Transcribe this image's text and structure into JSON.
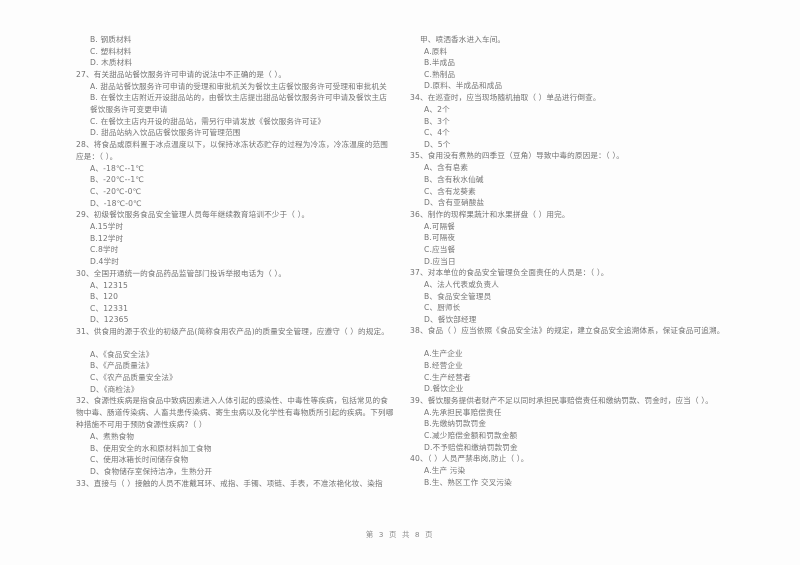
{
  "document": {
    "type": "exam-paper",
    "footer": {
      "prefix": "第",
      "page_number": "3",
      "middle": "页  共",
      "total_pages": "8",
      "suffix": "页",
      "full_text": "第 3 页  共 8 页"
    }
  },
  "left_column": {
    "continued_options": [
      "B. 钢质材料",
      "C. 塑料材料",
      "D. 木质材料"
    ],
    "questions": [
      {
        "number": "27",
        "text": "27、有关甜品站餐饮服务许可申请的说法中不正确的是（      ）。",
        "options": [
          "A. 甜品站餐饮服务许可申请的受理和审批机关为餐饮主店餐饮服务许可受理和审批机关",
          "B. 在餐饮主店附近开设甜品站的，由餐饮主店提出甜品站餐饮服务许可申请及餐饮主店餐饮服务许可变更申请",
          "C. 在餐饮主店内开设的甜品站，需另行申请发放《餐饮服务许可证》",
          "D. 甜品站纳入饮品店餐饮服务许可管理范围"
        ]
      },
      {
        "number": "28",
        "text": "28、将食品或原料置于冰点温度以下，以保持冰冻状态贮存的过程为冷冻，冷冻温度的范围应是：（      ）。",
        "options": [
          "A、-18℃--1℃",
          "B、-20℃--1℃",
          "C、-20℃-0℃",
          "D、-18℃-0℃"
        ]
      },
      {
        "number": "29",
        "text": "29、初级餐饮服务食品安全管理人员每年继续教育培训不少于（      ）。",
        "options": [
          "A.15学时",
          "B.12学时",
          "C.8学时",
          "D.4学时"
        ]
      },
      {
        "number": "30",
        "text": "30、全国开通统一的食品药品监管部门投诉举报电话为（      ）。",
        "options": [
          "A、12315",
          "B、120",
          "C、12331",
          "D、12365"
        ]
      },
      {
        "number": "31",
        "text": "31、供食用的源于农业的初级产品(简称食用农产品)的质量安全管理，应遵守（      ）的规定。",
        "options": [
          "A、《食品安全法》",
          "B、《产品质量法》",
          "C、《农产品质量安全法》",
          "D、《商检法》"
        ]
      },
      {
        "number": "32",
        "text": "32、食源性疾病是指食品中致病因素进入人体引起的感染性、中毒性等疾病，包括常见的食物中毒、肠道传染病、人畜共患传染病、寄生虫病以及化学性有毒物质所引起的疾病。下列哪种措施不可用于预防食源性疾病?（      ）",
        "options": [
          "A、煮熟食物",
          "B、使用安全的水和原材料加工食物",
          "C、使用冰箱长时间储存食物",
          "D、食物储存室保持洁净，生熟分开"
        ]
      },
      {
        "number": "33",
        "text": "33、直接与（      ）接触的人员不准戴耳环、戒指、手镯、项链、手表，不准浓艳化妆、染指",
        "options": []
      }
    ]
  },
  "right_column": {
    "continued_lead": "甲、喷洒香水进入车间。",
    "continued_options": [
      "A.原料",
      "B.半成品",
      "C.熟制品",
      "D.原料、半成品和成品"
    ],
    "questions": [
      {
        "number": "34",
        "text": "34、在巡查时，应当现场随机抽取（      ）单品进行倒查。",
        "options": [
          "A、2个",
          "B、3个",
          "C、4个",
          "D、5个"
        ]
      },
      {
        "number": "35",
        "text": "35、食用没有煮熟的四季豆（豆角）导致中毒的原因是：（      ）。",
        "options": [
          "A、含有皂素",
          "B、含有秋水仙碱",
          "C、含有龙葵素",
          "D、含有亚硝酸盐"
        ]
      },
      {
        "number": "36",
        "text": "36、制作的现榨果蔬汁和水果拼盘（      ）用完。",
        "options": [
          "A.可隔餐",
          "B.可隔夜",
          "C.应当餐",
          "D.应当日"
        ]
      },
      {
        "number": "37",
        "text": "37、对本单位的食品安全管理负全面责任的人员是：（      ）。",
        "options": [
          "A、法人代表或负责人",
          "B、食品安全管理员",
          "C、厨师长",
          "D、餐饮部经理"
        ]
      },
      {
        "number": "38",
        "text": "38、食品（      ）应当依照《食品安全法》的规定，建立食品安全追溯体系，保证食品可追溯。",
        "options": [
          "A.生产企业",
          "B.经营企业",
          "C.生产经营者",
          "D.餐饮企业"
        ]
      },
      {
        "number": "39",
        "text": "39、餐饮服务提供者财产不足以同时承担民事赔偿责任和缴纳罚款、罚金时，应当（      ）。",
        "options": [
          "A.先承担民事赔偿责任",
          "B.先缴纳罚款罚金",
          "C.减少赔偿金额和罚款金额",
          "D.不予赔偿和缴纳罚款罚金"
        ]
      },
      {
        "number": "40",
        "text": "40、（      ）人员严禁串岗,防止（      ）。",
        "options": [
          "A.生产  污染",
          "B.生、熟区工作  交叉污染"
        ]
      }
    ]
  }
}
